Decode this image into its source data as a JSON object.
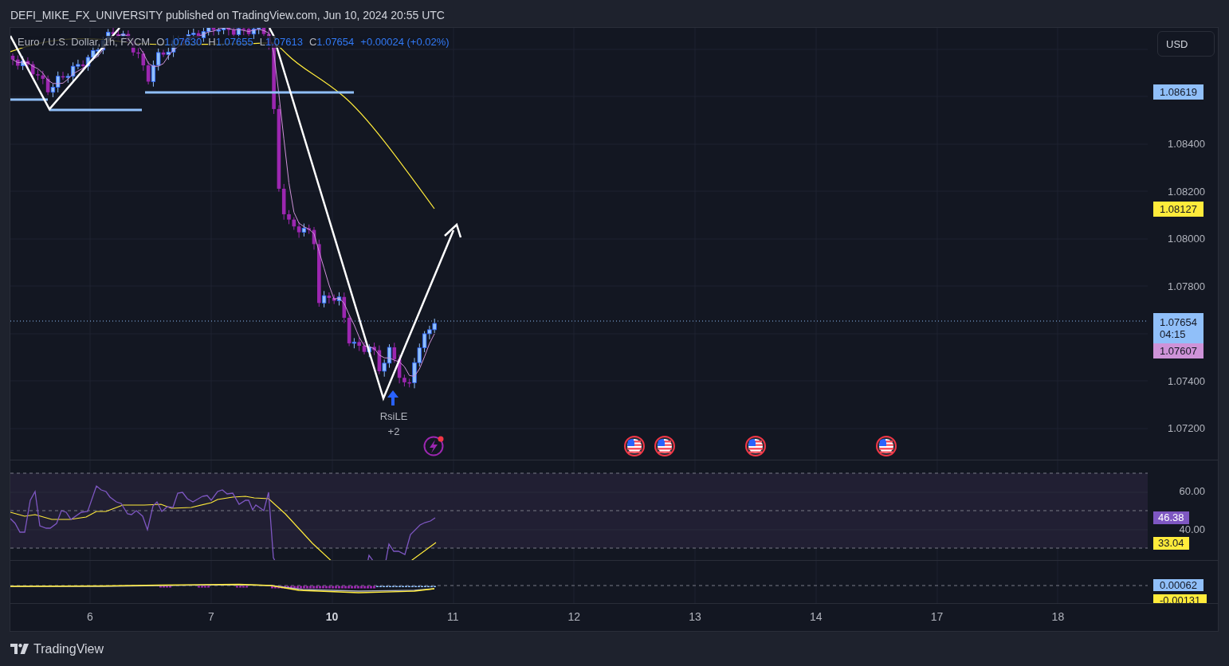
{
  "header": {
    "text": "DEFI_MIKE_FX_UNIVERSITY published on TradingView.com, Jun 10, 2024 20:55 UTC"
  },
  "legend": {
    "symbol": "Euro / U.S. Dollar, 1h, FXCM",
    "values": [
      {
        "label": "O",
        "value": "1.07630"
      },
      {
        "label": "H",
        "value": "1.07655"
      },
      {
        "label": "L",
        "value": "1.07613"
      },
      {
        "label": "C",
        "value": "1.07654"
      }
    ],
    "change": "+0.00024 (+0.02%)"
  },
  "price_axis": {
    "currency": "USD",
    "ticks": [
      "1.08400",
      "1.08200",
      "1.08000",
      "1.07800",
      "1.07400",
      "1.07200"
    ],
    "badges": [
      {
        "value": "1.08619",
        "color": "#90bff9"
      },
      {
        "value": "1.08127",
        "color": "#ffeb3b"
      },
      {
        "value": "1.07654",
        "countdown": "04:15",
        "color": "#90bff9"
      },
      {
        "value": "1.07607",
        "color": "#ce93d8"
      }
    ]
  },
  "signal": {
    "label": "RsiLE",
    "count": "+2"
  },
  "rsi_axis": {
    "ticks": [
      "60.00",
      "40.00"
    ],
    "badges": [
      {
        "value": "46.38",
        "color": "#7e57c2"
      },
      {
        "value": "33.04",
        "color": "#ffeb3b"
      }
    ]
  },
  "macd_axis": {
    "badges": [
      {
        "value": "0.00062",
        "color": "#90bff9"
      },
      {
        "value": "-0.00131",
        "color": "#ffeb3b"
      }
    ]
  },
  "time_axis": {
    "labels": [
      {
        "text": "6",
        "emphasized": false
      },
      {
        "text": "7",
        "emphasized": false
      },
      {
        "text": "10",
        "emphasized": true
      },
      {
        "text": "11",
        "emphasized": false
      },
      {
        "text": "12",
        "emphasized": false
      },
      {
        "text": "13",
        "emphasized": false
      },
      {
        "text": "14",
        "emphasized": false
      },
      {
        "text": "17",
        "emphasized": false
      },
      {
        "text": "18",
        "emphasized": false
      }
    ]
  },
  "footer": {
    "brand": "TradingView"
  }
}
